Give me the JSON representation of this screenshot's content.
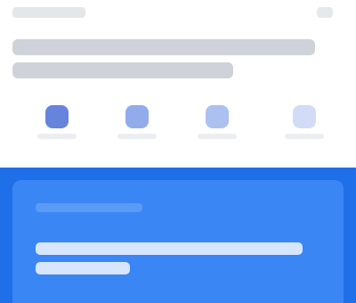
{
  "topbar": {
    "label": "",
    "action": ""
  },
  "headline": {
    "text": ""
  },
  "quick_actions": [
    {
      "label": "",
      "icon": "shield-icon",
      "color": "#4b6fd6"
    },
    {
      "label": "",
      "icon": "document-icon",
      "color": "#6d8fe3"
    },
    {
      "label": "",
      "icon": "calendar-icon",
      "color": "#8aa6ea"
    },
    {
      "label": "",
      "icon": "chat-icon",
      "color": "#b4c5f2"
    }
  ],
  "promo_card": {
    "eyebrow": "",
    "text": "",
    "background": "#1f6fe8",
    "accent": "#3a86f4"
  }
}
